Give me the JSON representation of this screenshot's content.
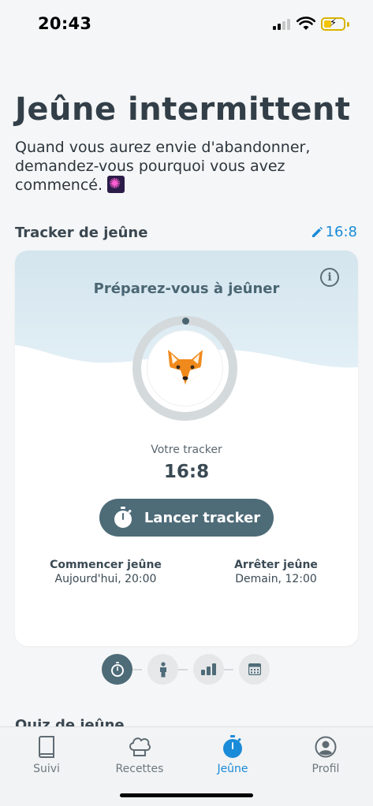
{
  "status_bar": {
    "time": "20:43"
  },
  "header": {
    "title": "Jeûne intermittent",
    "quote": "Quand vous aurez envie d'abandonner, demandez-vous pourquoi vous avez commencé.",
    "quote_emoji": "fireworks-icon"
  },
  "tracker_section": {
    "heading": "Tracker de jeûne",
    "plan_link": "16:8"
  },
  "card": {
    "title": "Préparez-vous à jeûner",
    "avatar": "fox-face-icon",
    "caption": "Votre tracker",
    "plan": "16:8",
    "button_label": "Lancer tracker",
    "start_label": "Commencer jeûne",
    "start_value": "Aujourd'hui, 20:00",
    "end_label": "Arrêter jeûne",
    "end_value": "Demain, 12:00"
  },
  "pager": {
    "items": [
      "stopwatch-icon",
      "person-icon",
      "bar-chart-icon",
      "calendar-icon"
    ],
    "active_index": 0
  },
  "next_section": {
    "heading": "Quiz de jeûne"
  },
  "tabbar": {
    "tabs": [
      {
        "label": "Suivi",
        "icon": "book-icon"
      },
      {
        "label": "Recettes",
        "icon": "chef-hat-icon"
      },
      {
        "label": "Jeûne",
        "icon": "stopwatch-icon"
      },
      {
        "label": "Profil",
        "icon": "user-icon"
      }
    ],
    "active_index": 2,
    "accent_color": "#1a8bd8"
  }
}
